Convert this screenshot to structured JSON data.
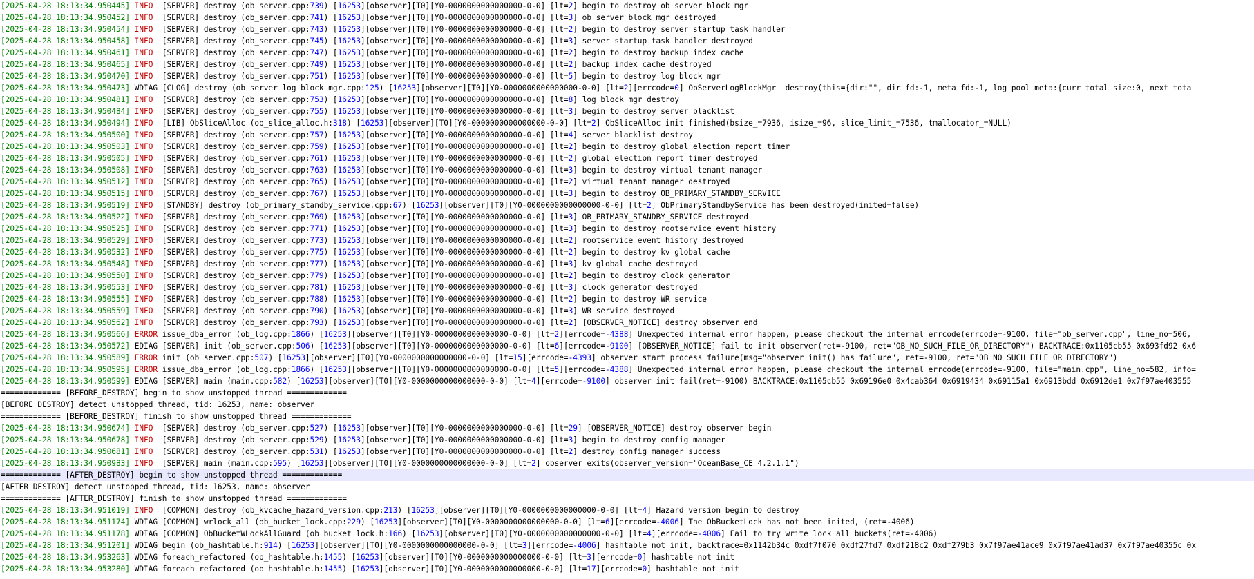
{
  "colors": {
    "background": "#ffffff",
    "text": "#000000",
    "timestamp": "#008000",
    "level": "#c00000",
    "number": "#0000ff",
    "highlight_row": "#e8e8ff"
  },
  "log_lines": [
    {
      "ts": "[2025-04-28 18:13:34.950445]",
      "lvl": "INFO",
      "mod": "[SERVER]",
      "fn": "destroy (ob_server.cpp:",
      "ln": "739",
      "tid": "16253",
      "lt": "2",
      "msg": "begin to destroy ob server block mgr"
    },
    {
      "ts": "[2025-04-28 18:13:34.950452]",
      "lvl": "INFO",
      "mod": "[SERVER]",
      "fn": "destroy (ob_server.cpp:",
      "ln": "741",
      "tid": "16253",
      "lt": "3",
      "msg": "ob server block mgr destroyed"
    },
    {
      "ts": "[2025-04-28 18:13:34.950454]",
      "lvl": "INFO",
      "mod": "[SERVER]",
      "fn": "destroy (ob_server.cpp:",
      "ln": "743",
      "tid": "16253",
      "lt": "2",
      "msg": "begin to destroy server startup task handler"
    },
    {
      "ts": "[2025-04-28 18:13:34.950458]",
      "lvl": "INFO",
      "mod": "[SERVER]",
      "fn": "destroy (ob_server.cpp:",
      "ln": "745",
      "tid": "16253",
      "lt": "3",
      "msg": "server startup task handler destroyed"
    },
    {
      "ts": "[2025-04-28 18:13:34.950461]",
      "lvl": "INFO",
      "mod": "[SERVER]",
      "fn": "destroy (ob_server.cpp:",
      "ln": "747",
      "tid": "16253",
      "lt": "2",
      "msg": "begin to destroy backup index cache"
    },
    {
      "ts": "[2025-04-28 18:13:34.950465]",
      "lvl": "INFO",
      "mod": "[SERVER]",
      "fn": "destroy (ob_server.cpp:",
      "ln": "749",
      "tid": "16253",
      "lt": "2",
      "msg": "backup index cache destroyed"
    },
    {
      "ts": "[2025-04-28 18:13:34.950470]",
      "lvl": "INFO",
      "mod": "[SERVER]",
      "fn": "destroy (ob_server.cpp:",
      "ln": "751",
      "tid": "16253",
      "lt": "5",
      "msg": "begin to destroy log block mgr"
    },
    {
      "ts": "[2025-04-28 18:13:34.950473]",
      "lvl": "WDIAG",
      "mod": "[CLOG]",
      "fn": "destroy (ob_server_log_block_mgr.cpp:",
      "ln": "125",
      "tid": "16253",
      "lt": "2",
      "ec": "0",
      "msg": "ObServerLogBlockMgr  destroy(this={dir:\"\", dir_fd:-1, meta_fd:-1, log_pool_meta:{curr_total_size:0, next_tota"
    },
    {
      "ts": "[2025-04-28 18:13:34.950481]",
      "lvl": "INFO",
      "mod": "[SERVER]",
      "fn": "destroy (ob_server.cpp:",
      "ln": "753",
      "tid": "16253",
      "lt": "8",
      "msg": "log block mgr destroy"
    },
    {
      "ts": "[2025-04-28 18:13:34.950484]",
      "lvl": "INFO",
      "mod": "[SERVER]",
      "fn": "destroy (ob_server.cpp:",
      "ln": "755",
      "tid": "16253",
      "lt": "3",
      "msg": "begin to destroy server blacklist"
    },
    {
      "ts": "[2025-04-28 18:13:34.950494]",
      "lvl": "INFO",
      "mod": "[LIB]",
      "fn": "ObSliceAlloc (ob_slice_alloc.h:",
      "ln": "318",
      "tid": "16253",
      "lt": "2",
      "msg": "ObSliceAlloc init finished(bsize_=7936, isize_=96, slice_limit_=7536, tmallocator_=NULL)"
    },
    {
      "ts": "[2025-04-28 18:13:34.950500]",
      "lvl": "INFO",
      "mod": "[SERVER]",
      "fn": "destroy (ob_server.cpp:",
      "ln": "757",
      "tid": "16253",
      "lt": "4",
      "msg": "server blacklist destroy"
    },
    {
      "ts": "[2025-04-28 18:13:34.950503]",
      "lvl": "INFO",
      "mod": "[SERVER]",
      "fn": "destroy (ob_server.cpp:",
      "ln": "759",
      "tid": "16253",
      "lt": "2",
      "msg": "begin to destroy global election report timer"
    },
    {
      "ts": "[2025-04-28 18:13:34.950505]",
      "lvl": "INFO",
      "mod": "[SERVER]",
      "fn": "destroy (ob_server.cpp:",
      "ln": "761",
      "tid": "16253",
      "lt": "2",
      "msg": "global election report timer destroyed"
    },
    {
      "ts": "[2025-04-28 18:13:34.950508]",
      "lvl": "INFO",
      "mod": "[SERVER]",
      "fn": "destroy (ob_server.cpp:",
      "ln": "763",
      "tid": "16253",
      "lt": "3",
      "msg": "begin to destroy virtual tenant manager"
    },
    {
      "ts": "[2025-04-28 18:13:34.950512]",
      "lvl": "INFO",
      "mod": "[SERVER]",
      "fn": "destroy (ob_server.cpp:",
      "ln": "765",
      "tid": "16253",
      "lt": "2",
      "msg": "virtual tenant manager destroyed"
    },
    {
      "ts": "[2025-04-28 18:13:34.950515]",
      "lvl": "INFO",
      "mod": "[SERVER]",
      "fn": "destroy (ob_server.cpp:",
      "ln": "767",
      "tid": "16253",
      "lt": "3",
      "msg": "begin to destroy OB_PRIMARY_STANDBY_SERVICE"
    },
    {
      "ts": "[2025-04-28 18:13:34.950519]",
      "lvl": "INFO",
      "mod": "[STANDBY]",
      "fn": "destroy (ob_primary_standby_service.cpp:",
      "ln": "67",
      "tid": "16253",
      "lt": "2",
      "msg": "ObPrimaryStandbyService has been destroyed(inited=false)"
    },
    {
      "ts": "[2025-04-28 18:13:34.950522]",
      "lvl": "INFO",
      "mod": "[SERVER]",
      "fn": "destroy (ob_server.cpp:",
      "ln": "769",
      "tid": "16253",
      "lt": "3",
      "msg": "OB_PRIMARY_STANDBY_SERVICE destroyed"
    },
    {
      "ts": "[2025-04-28 18:13:34.950525]",
      "lvl": "INFO",
      "mod": "[SERVER]",
      "fn": "destroy (ob_server.cpp:",
      "ln": "771",
      "tid": "16253",
      "lt": "3",
      "msg": "begin to destroy rootservice event history"
    },
    {
      "ts": "[2025-04-28 18:13:34.950529]",
      "lvl": "INFO",
      "mod": "[SERVER]",
      "fn": "destroy (ob_server.cpp:",
      "ln": "773",
      "tid": "16253",
      "lt": "2",
      "msg": "rootservice event history destroyed"
    },
    {
      "ts": "[2025-04-28 18:13:34.950532]",
      "lvl": "INFO",
      "mod": "[SERVER]",
      "fn": "destroy (ob_server.cpp:",
      "ln": "775",
      "tid": "16253",
      "lt": "2",
      "msg": "begin to destroy kv global cache"
    },
    {
      "ts": "[2025-04-28 18:13:34.950548]",
      "lvl": "INFO",
      "mod": "[SERVER]",
      "fn": "destroy (ob_server.cpp:",
      "ln": "777",
      "tid": "16253",
      "lt": "3",
      "msg": "kv global cache destroyed"
    },
    {
      "ts": "[2025-04-28 18:13:34.950550]",
      "lvl": "INFO",
      "mod": "[SERVER]",
      "fn": "destroy (ob_server.cpp:",
      "ln": "779",
      "tid": "16253",
      "lt": "2",
      "msg": "begin to destroy clock generator"
    },
    {
      "ts": "[2025-04-28 18:13:34.950553]",
      "lvl": "INFO",
      "mod": "[SERVER]",
      "fn": "destroy (ob_server.cpp:",
      "ln": "781",
      "tid": "16253",
      "lt": "3",
      "msg": "clock generator destroyed"
    },
    {
      "ts": "[2025-04-28 18:13:34.950555]",
      "lvl": "INFO",
      "mod": "[SERVER]",
      "fn": "destroy (ob_server.cpp:",
      "ln": "788",
      "tid": "16253",
      "lt": "2",
      "msg": "begin to destroy WR service"
    },
    {
      "ts": "[2025-04-28 18:13:34.950559]",
      "lvl": "INFO",
      "mod": "[SERVER]",
      "fn": "destroy (ob_server.cpp:",
      "ln": "790",
      "tid": "16253",
      "lt": "3",
      "msg": "WR service destroyed"
    },
    {
      "ts": "[2025-04-28 18:13:34.950562]",
      "lvl": "INFO",
      "mod": "[SERVER]",
      "fn": "destroy (ob_server.cpp:",
      "ln": "793",
      "tid": "16253",
      "lt": "2",
      "msg": "[OBSERVER_NOTICE] destroy observer end"
    },
    {
      "ts": "[2025-04-28 18:13:34.950566]",
      "lvl": "ERROR",
      "mod": "",
      "fn": "issue_dba_error (ob_log.cpp:",
      "ln": "1866",
      "tid": "16253",
      "lt": "2",
      "ec": "-4388",
      "msg": "Unexpected internal error happen, please checkout the internal errcode(errcode=-9100, file=\"ob_server.cpp\", line_no=506,"
    },
    {
      "ts": "[2025-04-28 18:13:34.950572]",
      "lvl": "EDIAG",
      "mod": "[SERVER]",
      "fn": "init (ob_server.cpp:",
      "ln": "506",
      "tid": "16253",
      "lt": "6",
      "ec": "-9100",
      "msg": "[OBSERVER_NOTICE] fail to init observer(ret=-9100, ret=\"OB_NO_SUCH_FILE_OR_DIRECTORY\") BACKTRACE:0x1105cb55 0x693fd92 0x6"
    },
    {
      "ts": "[2025-04-28 18:13:34.950589]",
      "lvl": "ERROR",
      "mod": "",
      "fn": "init (ob_server.cpp:",
      "ln": "507",
      "tid": "16253",
      "lt": "15",
      "ec": "-4393",
      "msg": "observer start process failure(msg=\"observer init() has failure\", ret=-9100, ret=\"OB_NO_SUCH_FILE_OR_DIRECTORY\")"
    },
    {
      "ts": "[2025-04-28 18:13:34.950595]",
      "lvl": "ERROR",
      "mod": "",
      "fn": "issue_dba_error (ob_log.cpp:",
      "ln": "1866",
      "tid": "16253",
      "lt": "5",
      "ec": "-4388",
      "msg": "Unexpected internal error happen, please checkout the internal errcode(errcode=-9100, file=\"main.cpp\", line_no=582, info="
    },
    {
      "ts": "[2025-04-28 18:13:34.950599]",
      "lvl": "EDIAG",
      "mod": "[SERVER]",
      "fn": "main (main.cpp:",
      "ln": "582",
      "tid": "16253",
      "lt": "4",
      "ec": "-9100",
      "msg": "observer init fail(ret=-9100) BACKTRACE:0x1105cb55 0x69196e0 0x4cab364 0x6919434 0x69115a1 0x6913bdd 0x6912de1 0x7f97ae403555"
    },
    {
      "plain": "============= [BEFORE_DESTROY] begin to show unstopped thread ============="
    },
    {
      "plain": "[BEFORE_DESTROY] detect unstopped thread, tid: 16253, name: observer"
    },
    {
      "plain": "============= [BEFORE_DESTROY] finish to show unstopped thread ============="
    },
    {
      "ts": "[2025-04-28 18:13:34.950674]",
      "lvl": "INFO",
      "mod": "[SERVER]",
      "fn": "destroy (ob_server.cpp:",
      "ln": "527",
      "tid": "16253",
      "lt": "29",
      "msg": "[OBSERVER_NOTICE] destroy observer begin"
    },
    {
      "ts": "[2025-04-28 18:13:34.950678]",
      "lvl": "INFO",
      "mod": "[SERVER]",
      "fn": "destroy (ob_server.cpp:",
      "ln": "529",
      "tid": "16253",
      "lt": "3",
      "msg": "begin to destroy config manager"
    },
    {
      "ts": "[2025-04-28 18:13:34.950681]",
      "lvl": "INFO",
      "mod": "[SERVER]",
      "fn": "destroy (ob_server.cpp:",
      "ln": "531",
      "tid": "16253",
      "lt": "2",
      "msg": "destroy config manager success"
    },
    {
      "ts": "[2025-04-28 18:13:34.950983]",
      "lvl": "INFO",
      "mod": "[SERVER]",
      "fn": "main (main.cpp:",
      "ln": "595",
      "tid": "16253",
      "lt": "2",
      "msg": "observer exits(observer_version=\"OceanBase_CE 4.2.1.1\")",
      "lt_plain": true
    },
    {
      "plain": "============= [AFTER_DESTROY] begin to show unstopped thread =============",
      "highlight": true
    },
    {
      "plain": "[AFTER_DESTROY] detect unstopped thread, tid: 16253, name: observer"
    },
    {
      "plain": "============= [AFTER_DESTROY] finish to show unstopped thread ============="
    },
    {
      "ts": "[2025-04-28 18:13:34.951019]",
      "lvl": "INFO",
      "mod": "[COMMON]",
      "fn": "destroy (ob_kvcache_hazard_version.cpp:",
      "ln": "213",
      "tid": "16253",
      "lt": "4",
      "msg": "Hazard version begin to destroy"
    },
    {
      "ts": "[2025-04-28 18:13:34.951174]",
      "lvl": "WDIAG",
      "mod": "[COMMON]",
      "fn": "wrlock_all (ob_bucket_lock.cpp:",
      "ln": "229",
      "tid": "16253",
      "lt": "6",
      "ec": "-4006",
      "msg": "The ObBucketLock has not been inited, (ret=-4006)"
    },
    {
      "ts": "[2025-04-28 18:13:34.951178]",
      "lvl": "WDIAG",
      "mod": "[COMMON]",
      "fn": "ObBucketWLockAllGuard (ob_bucket_lock.h:",
      "ln": "166",
      "tid": "16253",
      "lt": "4",
      "ec": "-4006",
      "msg": "Fail to try write lock all buckets(ret=-4006)"
    },
    {
      "ts": "[2025-04-28 18:13:34.951201]",
      "lvl": "WDIAG",
      "mod": "",
      "fn": "begin (ob_hashtable.h:",
      "ln": "914",
      "tid": "16253",
      "lt": "3",
      "ec": "-4006",
      "msg": "hashtable not init, backtrace=0x1142b34c 0xdf7f070 0xdf27fd7 0xdf218c2 0xdf279b3 0x7f97ae41ace9 0x7f97ae41ad37 0x7f97ae40355c 0x"
    },
    {
      "ts": "[2025-04-28 18:13:34.953263]",
      "lvl": "WDIAG",
      "mod": "",
      "fn": "foreach_refactored (ob_hashtable.h:",
      "ln": "1455",
      "tid": "16253",
      "lt": "3",
      "ec": "0",
      "msg": "hashtable not init"
    },
    {
      "ts": "[2025-04-28 18:13:34.953280]",
      "lvl": "WDIAG",
      "mod": "",
      "fn": "foreach_refactored (ob_hashtable.h:",
      "ln": "1455",
      "tid": "16253",
      "lt": "17",
      "ec": "0",
      "msg": "hashtable not init"
    }
  ]
}
